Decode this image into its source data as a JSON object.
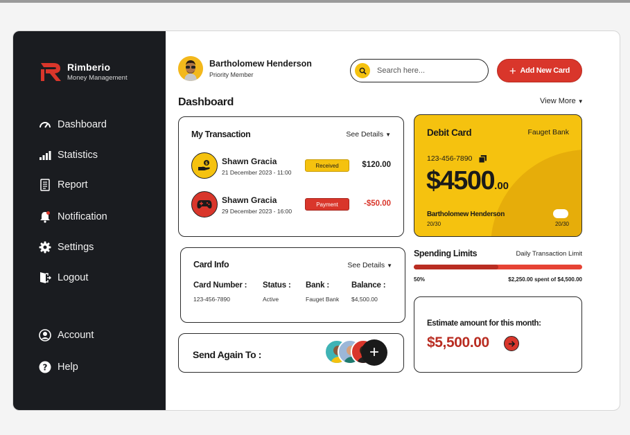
{
  "brand": {
    "name": "Rimberio",
    "tagline": "Money Management"
  },
  "nav": {
    "main": [
      {
        "label": "Dashboard",
        "icon": "gauge-icon"
      },
      {
        "label": "Statistics",
        "icon": "chart-bars-icon"
      },
      {
        "label": "Report",
        "icon": "document-icon"
      },
      {
        "label": "Notification",
        "icon": "bell-icon"
      },
      {
        "label": "Settings",
        "icon": "gear-icon"
      },
      {
        "label": "Logout",
        "icon": "logout-icon"
      }
    ],
    "bottom": [
      {
        "label": "Account",
        "icon": "user-circle-icon"
      },
      {
        "label": "Help",
        "icon": "help-icon"
      }
    ]
  },
  "user": {
    "name": "Bartholomew Henderson",
    "tier": "Priority Member"
  },
  "search": {
    "placeholder": "Search here..."
  },
  "add_card_label": "Add New Card",
  "dashboard": {
    "title": "Dashboard",
    "view_more": "View More"
  },
  "transactions": {
    "title": "My Transaction",
    "see_details": "See Details",
    "items": [
      {
        "name": "Shawn Gracia",
        "date": "21 December 2023 - 11:00",
        "status": "Received",
        "amount": "$120.00"
      },
      {
        "name": "Shawn Gracia",
        "date": "29 December 2023 - 16:00",
        "status": "Payment",
        "amount": "-$50.00"
      }
    ]
  },
  "card_info": {
    "title": "Card Info",
    "see_details": "See Details",
    "columns": [
      {
        "label": "Card Number :",
        "value": "123-456-7890"
      },
      {
        "label": "Status :",
        "value": "Active"
      },
      {
        "label": "Bank :",
        "value": "Fauget Bank"
      },
      {
        "label": "Balance :",
        "value": "$4,500.00"
      }
    ]
  },
  "send_again": {
    "title": "Send Again To :"
  },
  "debit_card": {
    "title": "Debit Card",
    "bank": "Fauget Bank",
    "number": "123-456-7890",
    "balance_main": "$4500",
    "balance_cents": ".00",
    "holder": "Bartholomew Henderson",
    "expiry_left": "20/30",
    "expiry_right": "20/30"
  },
  "spending": {
    "title": "Spending Limits",
    "daily_label": "Daily Transaction Limit",
    "percent_label": "50%",
    "progress": 0.5,
    "detail": "$2,250.00 spent of $4,500.00"
  },
  "estimate": {
    "label": "Estimate amount for this month:",
    "value": "$5,500.00"
  },
  "colors": {
    "accent_red": "#d9362b",
    "accent_yellow": "#f5c20f",
    "sidebar": "#1a1c20"
  }
}
